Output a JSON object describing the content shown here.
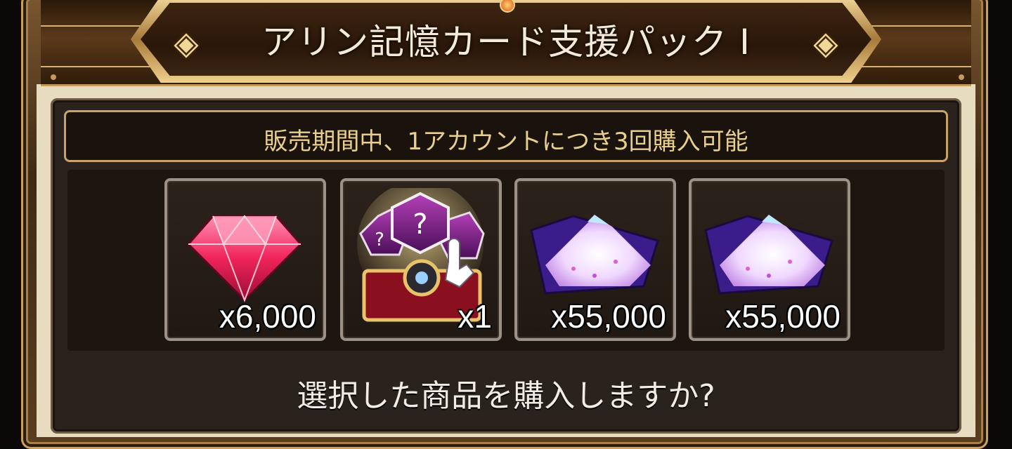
{
  "dialog": {
    "title": "アリン記憶カード支援パック I",
    "notice": "販売期間中、1アカウントにつき3回購入可能",
    "question": "選択した商品を購入しますか?"
  },
  "items": [
    {
      "name": "ruby-gem",
      "quantity": "x6,000"
    },
    {
      "name": "memory-card-selection-box",
      "quantity": "x1"
    },
    {
      "name": "crystal-powder",
      "quantity": "x55,000"
    },
    {
      "name": "crystal-powder",
      "quantity": "x55,000"
    }
  ],
  "colors": {
    "frame_gold": "#c9a062",
    "notice_text": "#e9cf8e",
    "panel_bg": "#2a221c"
  }
}
